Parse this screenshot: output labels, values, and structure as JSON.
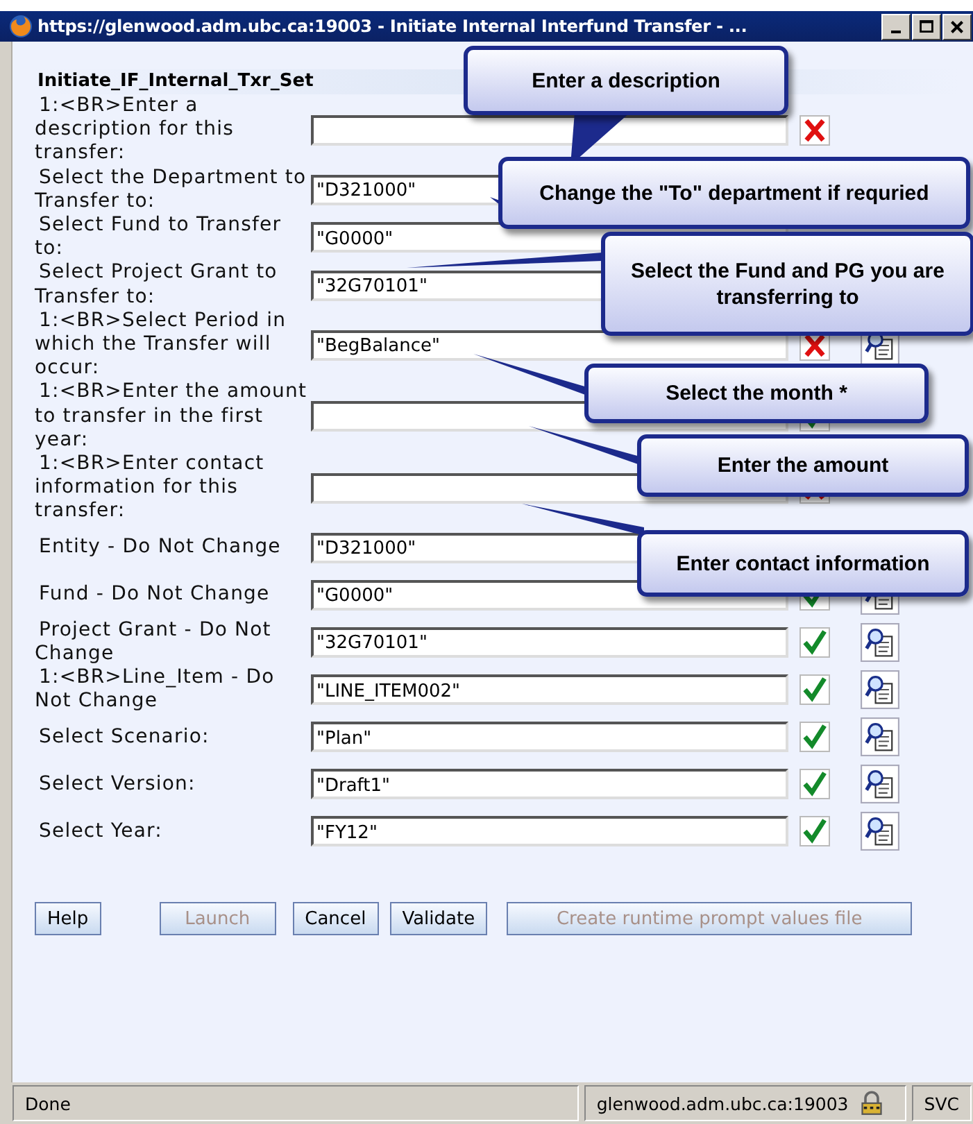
{
  "window": {
    "title": "https://glenwood.adm.ubc.ca:19003 - Initiate Internal Interfund Transfer - ..."
  },
  "form": {
    "heading": "Initiate_IF_Internal_Txr_Set",
    "rows": [
      {
        "label": "1:<BR>Enter a description for this transfer:",
        "valid": false
      },
      {
        "label": "Select the Department to Transfer to:",
        "value": "\"D321000\""
      },
      {
        "label": "Select Fund to Transfer to:",
        "value": "\"G0000\""
      },
      {
        "label": "Select Project Grant to Transfer to:",
        "value": "\"32G70101\""
      },
      {
        "label": "1:<BR>Select Period in which the Transfer will occur:",
        "value": "\"BegBalance\"",
        "valid": false,
        "lookup": true
      },
      {
        "label": "1:<BR>Enter the amount to transfer in the first year:",
        "valid": true
      },
      {
        "label": "1:<BR>Enter contact information for this transfer:",
        "valid": false
      },
      {
        "label": "Entity - Do Not Change",
        "value": "\"D321000\""
      },
      {
        "label": "Fund - Do Not Change",
        "value": "\"G0000\"",
        "valid": true,
        "lookup": true
      },
      {
        "label": "Project Grant - Do Not Change",
        "value": "\"32G70101\"",
        "valid": true,
        "lookup": true
      },
      {
        "label": "1:<BR>Line_Item - Do Not Change",
        "value": "\"LINE_ITEM002\"",
        "valid": true,
        "lookup": true
      },
      {
        "label": "Select Scenario:",
        "value": "\"Plan\"",
        "valid": true,
        "lookup": true
      },
      {
        "label": "Select Version:",
        "value": "\"Draft1\"",
        "valid": true,
        "lookup": true
      },
      {
        "label": "Select Year:",
        "value": "\"FY12\"",
        "valid": true,
        "lookup": true
      }
    ]
  },
  "buttons": [
    {
      "label": "Help",
      "disabled": false
    },
    {
      "label": "Launch",
      "disabled": true
    },
    {
      "label": "Cancel",
      "disabled": false
    },
    {
      "label": "Validate",
      "disabled": false
    },
    {
      "label": "Create runtime prompt values file",
      "disabled": true
    }
  ],
  "callouts": [
    {
      "text": "Enter a description",
      "kind": "tail"
    },
    {
      "text": "Change the \"To\" department if requried",
      "kind": "line"
    },
    {
      "text": "Select the Fund and PG you are transferring to",
      "kind": "line"
    },
    {
      "text": "Select the month *",
      "kind": "line"
    },
    {
      "text": "Enter the amount",
      "kind": "line"
    },
    {
      "text": "Enter contact information",
      "kind": "line"
    }
  ],
  "status_bar": {
    "text": "Done",
    "host": "glenwood.adm.ubc.ca:19003",
    "zone": "SVC"
  }
}
